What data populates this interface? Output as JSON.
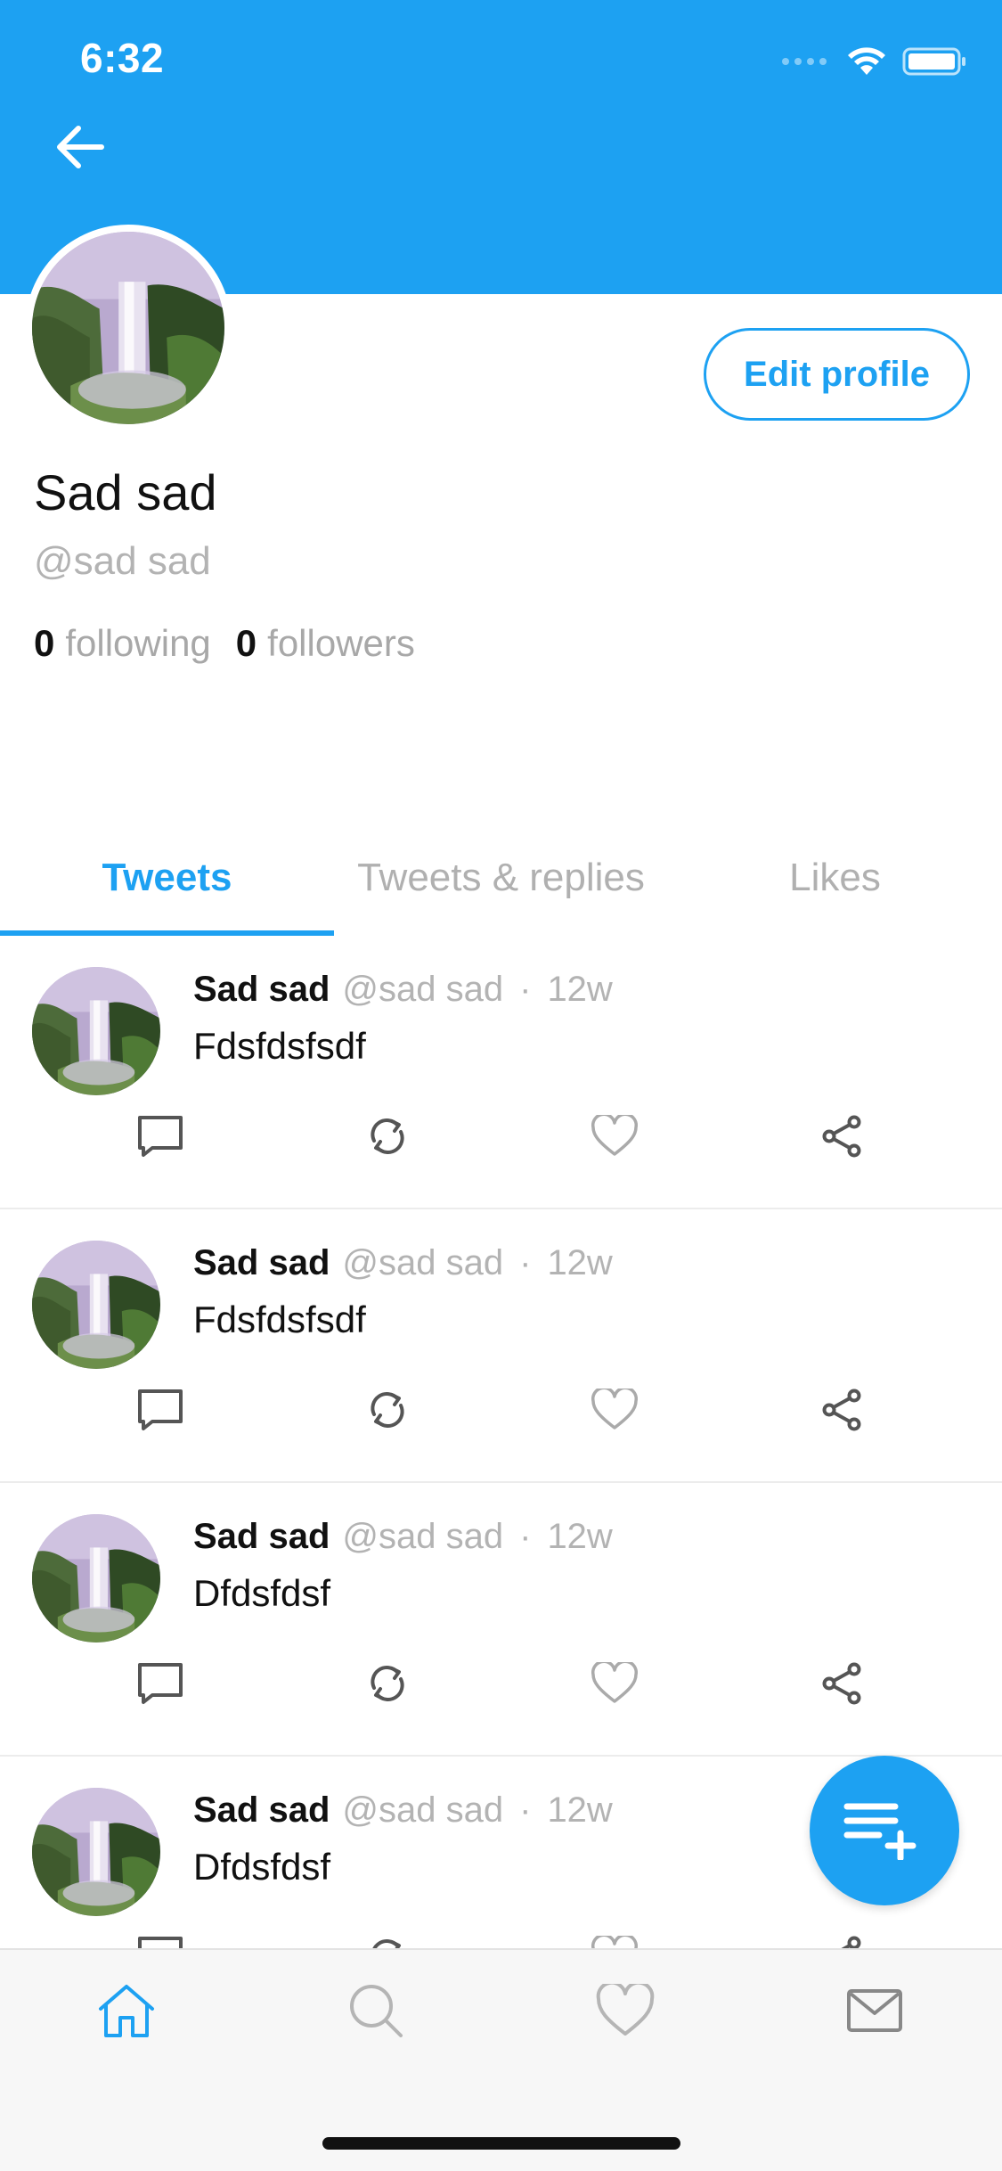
{
  "status_bar": {
    "time": "6:32"
  },
  "profile": {
    "display_name": "Sad sad",
    "handle": "@sad sad",
    "following_count": "0",
    "following_label": "following",
    "followers_count": "0",
    "followers_label": "followers",
    "edit_button_label": "Edit profile"
  },
  "tabs": [
    {
      "label": "Tweets",
      "active": true
    },
    {
      "label": "Tweets & replies",
      "active": false
    },
    {
      "label": "Likes",
      "active": false
    }
  ],
  "tweets": [
    {
      "name": "Sad sad",
      "handle": "@sad sad",
      "dot": "·",
      "time": "12w",
      "text": "Fdsfdsfsdf"
    },
    {
      "name": "Sad sad",
      "handle": "@sad sad",
      "dot": "·",
      "time": "12w",
      "text": "Fdsfdsfsdf"
    },
    {
      "name": "Sad sad",
      "handle": "@sad sad",
      "dot": "·",
      "time": "12w",
      "text": "Dfdsfdsf"
    },
    {
      "name": "Sad sad",
      "handle": "@sad sad",
      "dot": "·",
      "time": "12w",
      "text": "Dfdsfdsf"
    }
  ],
  "icons": {
    "back": "arrow-left-icon",
    "reply": "comment-icon",
    "retweet": "retweet-icon",
    "like": "heart-icon",
    "share": "share-icon",
    "compose": "compose-tweet-icon",
    "nav": [
      "home-icon",
      "search-icon",
      "heart-icon",
      "mail-icon"
    ]
  },
  "colors": {
    "brand": "#1da1f2",
    "text": "#111111",
    "muted": "#b3b3b3",
    "nav_bg": "#f7f7f7"
  }
}
